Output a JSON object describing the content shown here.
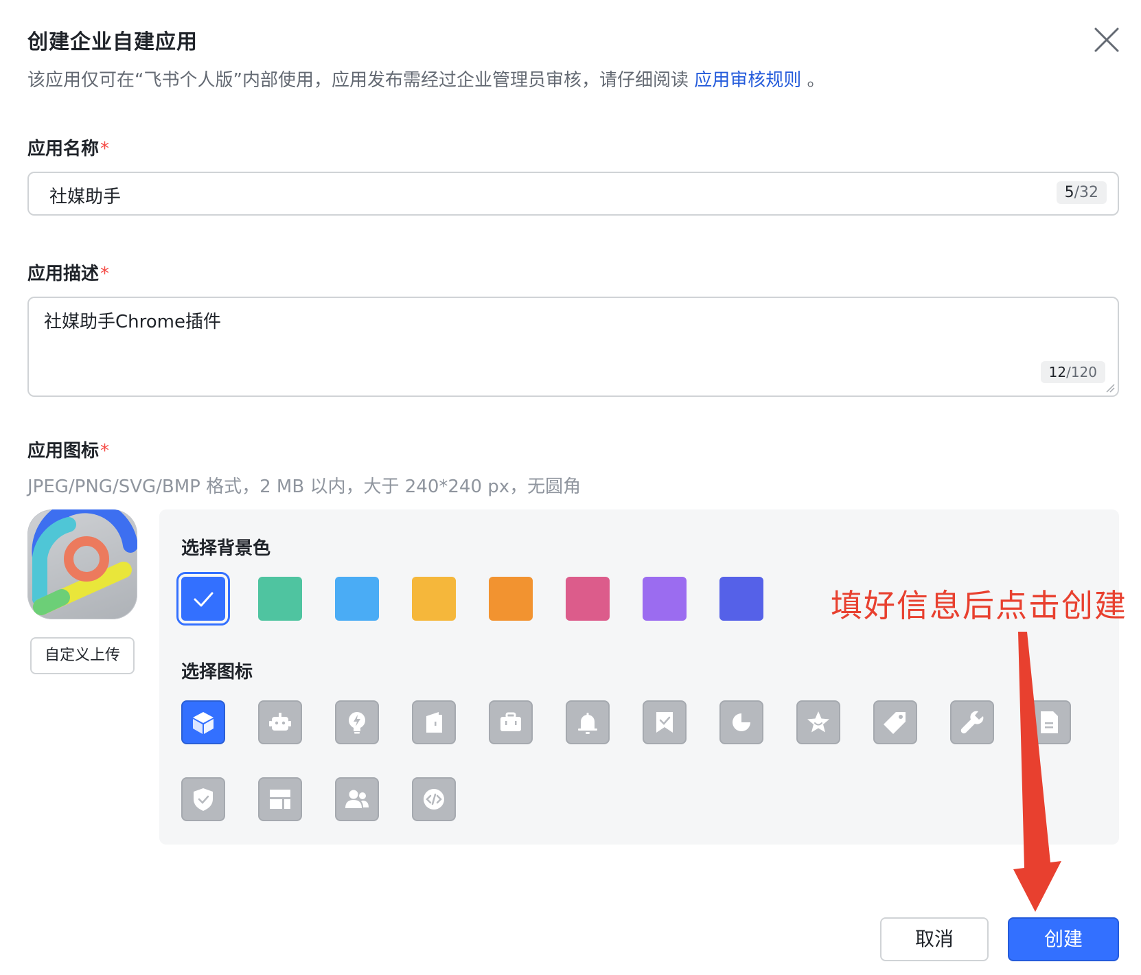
{
  "dialog": {
    "title": "创建企业自建应用",
    "notice_text": "该应用仅可在“飞书个人版”内部使用，应用发布需经过企业管理员审核，请仔细阅读",
    "notice_link": "应用审核规则",
    "notice_end": "。"
  },
  "app_name": {
    "label": "应用名称",
    "required_mark": "*",
    "value": "社媒助手",
    "count_current": "5",
    "count_max": "/32"
  },
  "app_desc": {
    "label": "应用描述",
    "required_mark": "*",
    "value": "社媒助手Chrome插件",
    "count_current": "12",
    "count_max": "/120"
  },
  "app_icon": {
    "label": "应用图标",
    "required_mark": "*",
    "hint": "JPEG/PNG/SVG/BMP 格式，2 MB 以内，大于 240*240 px，无圆角",
    "upload_label": "自定义上传",
    "bg_section_title": "选择背景色",
    "icon_section_title": "选择图标",
    "bg_colors": [
      "#3370ff",
      "#4fc4a0",
      "#4aacf5",
      "#f5b73b",
      "#f29330",
      "#dc5c8b",
      "#9b6cf0",
      "#5561e8"
    ],
    "selected_bg_index": 0,
    "icons": [
      "cube-icon",
      "robot-icon",
      "lightbulb-icon",
      "door-icon",
      "briefcase-icon",
      "bell-icon",
      "bookmark-check-icon",
      "pie-chart-icon",
      "star-icon",
      "tag-icon",
      "wrench-icon",
      "document-icon",
      "shield-check-icon",
      "layout-icon",
      "users-icon",
      "code-icon"
    ],
    "selected_icon_index": 0
  },
  "annotation": {
    "text": "填好信息后点击创建",
    "color": "#e8402f"
  },
  "footer": {
    "cancel_label": "取消",
    "create_label": "创建"
  }
}
